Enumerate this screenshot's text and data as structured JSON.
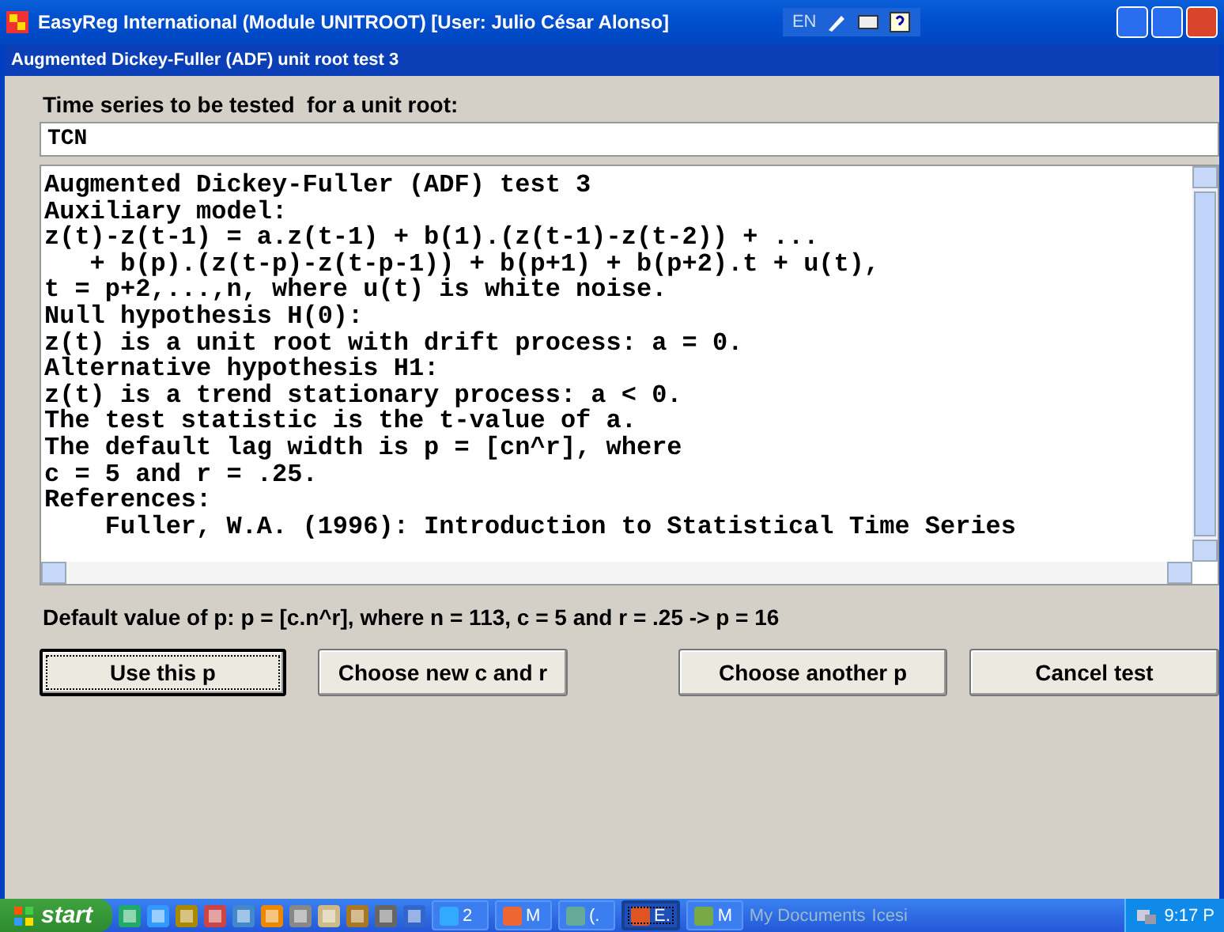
{
  "window": {
    "title": "EasyReg International (Module UNITROOT) [User: Julio César Alonso]",
    "language": "EN"
  },
  "dialog": {
    "title": "Augmented Dickey-Fuller (ADF) unit root test 3",
    "series_label": "Time series to be tested  for a unit root:",
    "series_field": {
      "value": "TCN"
    },
    "output_lines": [
      "Augmented Dickey-Fuller (ADF) test 3",
      "Auxiliary model:",
      "z(t)-z(t-1) = a.z(t-1) + b(1).(z(t-1)-z(t-2)) + ...",
      "   + b(p).(z(t-p)-z(t-p-1)) + b(p+1) + b(p+2).t + u(t),",
      "t = p+2,...,n, where u(t) is white noise.",
      "Null hypothesis H(0):",
      "z(t) is a unit root with drift process: a = 0.",
      "Alternative hypothesis H1:",
      "z(t) is a trend stationary process: a < 0.",
      "The test statistic is the t-value of a.",
      "The default lag width is p = [cn^r], where",
      "c = 5 and r = .25.",
      "References:",
      "    Fuller, W.A. (1996): Introduction to Statistical Time Series"
    ],
    "default_text": "Default value of p: p = [c.n^r], where n = 113, c = 5 and r = .25 -> p = 16",
    "buttons": [
      {
        "label": "Use this p",
        "selected": true
      },
      {
        "label": "Choose new c and r",
        "selected": false
      },
      {
        "label": "Choose another p",
        "selected": false
      },
      {
        "label": "Cancel test",
        "selected": false
      }
    ]
  },
  "taskbar": {
    "start": "start",
    "tasks": [
      {
        "label": "2",
        "selected": false
      },
      {
        "label": "M",
        "selected": false
      },
      {
        "label": "(.",
        "selected": false
      },
      {
        "label": "E.",
        "selected": true
      },
      {
        "label": "M",
        "selected": false
      }
    ],
    "toolbars": [
      "My Documents",
      "Icesi"
    ],
    "clock": "9:17 P"
  }
}
